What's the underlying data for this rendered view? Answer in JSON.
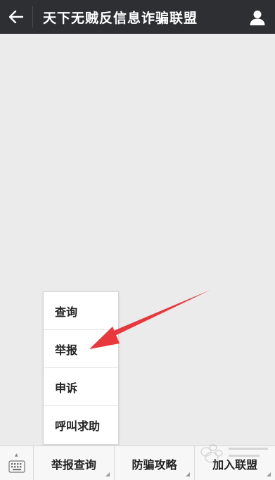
{
  "header": {
    "title": "天下无贼反信息诈骗联盟",
    "back_icon": "arrow-left-icon",
    "profile_icon": "user-icon",
    "background": "#2d2f33"
  },
  "popup_menu": {
    "items": [
      {
        "label": "查询"
      },
      {
        "label": "举报"
      },
      {
        "label": "申诉"
      },
      {
        "label": "呼叫求助"
      }
    ]
  },
  "annotation": {
    "type": "arrow",
    "color": "#e8383d"
  },
  "bottom_menu": {
    "keyboard_icon": "keyboard-icon",
    "tabs": [
      {
        "label": "举报查询"
      },
      {
        "label": "防骗攻略"
      },
      {
        "label": "加入联盟"
      }
    ]
  }
}
